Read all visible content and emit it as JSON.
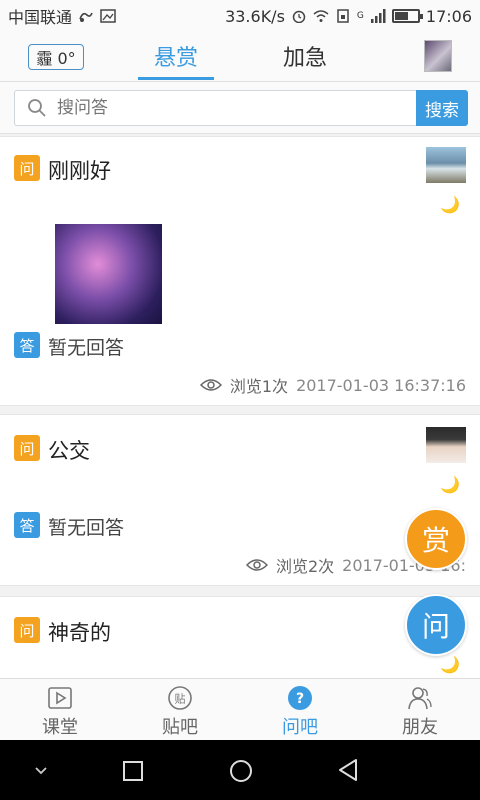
{
  "statusbar": {
    "carrier": "中国联通",
    "speed": "33.6K/s",
    "network_type": "G",
    "time": "17:06",
    "battery_level": 0.6
  },
  "topnav": {
    "weather": "霾 0°",
    "tab_active": "悬赏",
    "tab_other": "加急"
  },
  "search": {
    "placeholder": "搜问答",
    "button_label": "搜索"
  },
  "questions": [
    {
      "q_badge": "问",
      "title": "刚刚好",
      "a_badge": "答",
      "answer": "暂无回答",
      "views": "浏览1次",
      "time": "2017-01-03 16:37:16"
    },
    {
      "q_badge": "问",
      "title": "公交",
      "a_badge": "答",
      "answer": "暂无回答",
      "views": "浏览2次",
      "time": "2017-01-03 16:"
    },
    {
      "q_badge": "问",
      "title": "神奇的"
    }
  ],
  "fab": {
    "reward_label": "赏",
    "ask_label": "问"
  },
  "bottomnav": {
    "items": [
      {
        "label": "课堂"
      },
      {
        "label": "贴吧",
        "icon_text": "贴"
      },
      {
        "label": "问吧",
        "icon_text": "?"
      },
      {
        "label": "朋友"
      }
    ],
    "active_color": "#3a9be0"
  },
  "colors": {
    "accent": "#3a9be0",
    "question_badge": "#f4a320",
    "reward_fab": "#f49b1a"
  }
}
